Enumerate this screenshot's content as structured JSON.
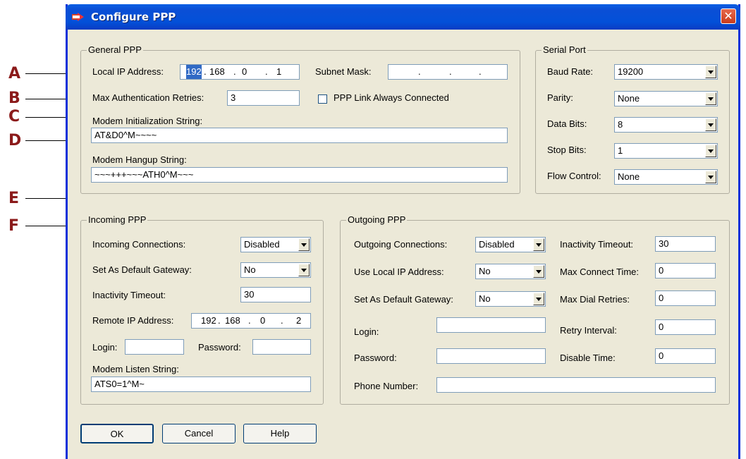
{
  "window": {
    "title": "Configure PPP",
    "close_label": "✕"
  },
  "callouts": {
    "a": "A",
    "b": "B",
    "c": "C",
    "d": "D",
    "e": "E",
    "f": "F"
  },
  "general": {
    "title": "General PPP",
    "local_ip_label": "Local IP Address:",
    "local_ip": [
      "192",
      "168",
      "0",
      "1"
    ],
    "subnet_label": "Subnet Mask:",
    "max_auth_label": "Max Authentication Retries:",
    "max_auth_value": "3",
    "link_always_label": "PPP Link Always Connected",
    "modem_init_label": "Modem Initialization String:",
    "modem_init_value": "AT&D0^M~~~~",
    "modem_hangup_label": "Modem Hangup String:",
    "modem_hangup_value": "~~~+++~~~ATH0^M~~~"
  },
  "serial": {
    "title": "Serial Port",
    "baud_label": "Baud Rate:",
    "baud_value": "19200",
    "parity_label": "Parity:",
    "parity_value": "None",
    "data_bits_label": "Data Bits:",
    "data_bits_value": "8",
    "stop_bits_label": "Stop Bits:",
    "stop_bits_value": "1",
    "flow_label": "Flow Control:",
    "flow_value": "None"
  },
  "incoming": {
    "title": "Incoming PPP",
    "connections_label": "Incoming Connections:",
    "connections_value": "Disabled",
    "gateway_label": "Set As Default Gateway:",
    "gateway_value": "No",
    "inactivity_label": "Inactivity Timeout:",
    "inactivity_value": "30",
    "remote_ip_label": "Remote IP Address:",
    "remote_ip": [
      "192",
      "168",
      "0",
      "2"
    ],
    "login_label": "Login:",
    "password_label": "Password:",
    "listen_label": "Modem Listen String:",
    "listen_value": "ATS0=1^M~"
  },
  "outgoing": {
    "title": "Outgoing PPP",
    "connections_label": "Outgoing Connections:",
    "connections_value": "Disabled",
    "use_local_label": "Use Local IP Address:",
    "use_local_value": "No",
    "gateway_label": "Set As Default Gateway:",
    "gateway_value": "No",
    "login_label": "Login:",
    "password_label": "Password:",
    "phone_label": "Phone Number:",
    "inactivity_label": "Inactivity Timeout:",
    "inactivity_value": "30",
    "max_connect_label": "Max Connect Time:",
    "max_connect_value": "0",
    "max_dial_label": "Max Dial Retries:",
    "max_dial_value": "0",
    "retry_label": "Retry Interval:",
    "retry_value": "0",
    "disable_label": "Disable Time:",
    "disable_value": "0"
  },
  "buttons": {
    "ok": "OK",
    "cancel": "Cancel",
    "help": "Help"
  }
}
